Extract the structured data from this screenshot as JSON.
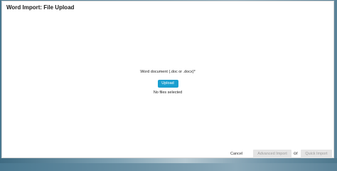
{
  "modal": {
    "title": "Word Import: File Upload"
  },
  "upload": {
    "field_label": "Word document (.doc or .docx)*",
    "upload_button": "Upload",
    "status": "No files selected"
  },
  "footer": {
    "cancel_label": "Cancel",
    "advanced_import_label": "Advanced Import",
    "or_label": "or",
    "quick_import_label": "Quick Import"
  },
  "colors": {
    "accent": "#1a9fd0",
    "disabled_bg": "#e4e4e4",
    "disabled_text": "#a0a0a0"
  }
}
